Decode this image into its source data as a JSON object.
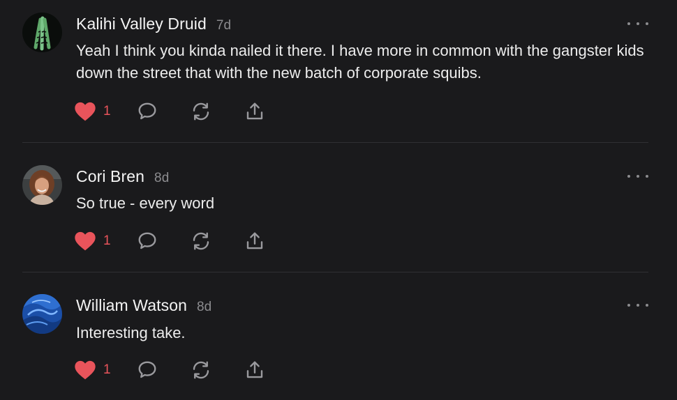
{
  "comments": [
    {
      "author": "Kalihi Valley Druid",
      "time": "7d",
      "text": "Yeah I think you kinda nailed it there. I have more in common with the gangster kids down the street that with the new batch of corporate squibs.",
      "likes": "1",
      "avatar_icon": "leaf-avatar"
    },
    {
      "author": "Cori Bren",
      "time": "8d",
      "text": "So true - every word",
      "likes": "1",
      "avatar_icon": "person-photo-avatar"
    },
    {
      "author": "William Watson",
      "time": "8d",
      "text": "Interesting take.",
      "likes": "1",
      "avatar_icon": "blue-swirl-avatar"
    }
  ],
  "icons": {
    "like": "heart-icon",
    "reply": "comment-bubble-icon",
    "restack": "restack-icon",
    "share": "share-icon",
    "more": "more-icon"
  },
  "colors": {
    "background": "#1a1a1c",
    "like": "#e9545b",
    "muted": "#8c8c8f",
    "divider": "#2f2f33"
  }
}
